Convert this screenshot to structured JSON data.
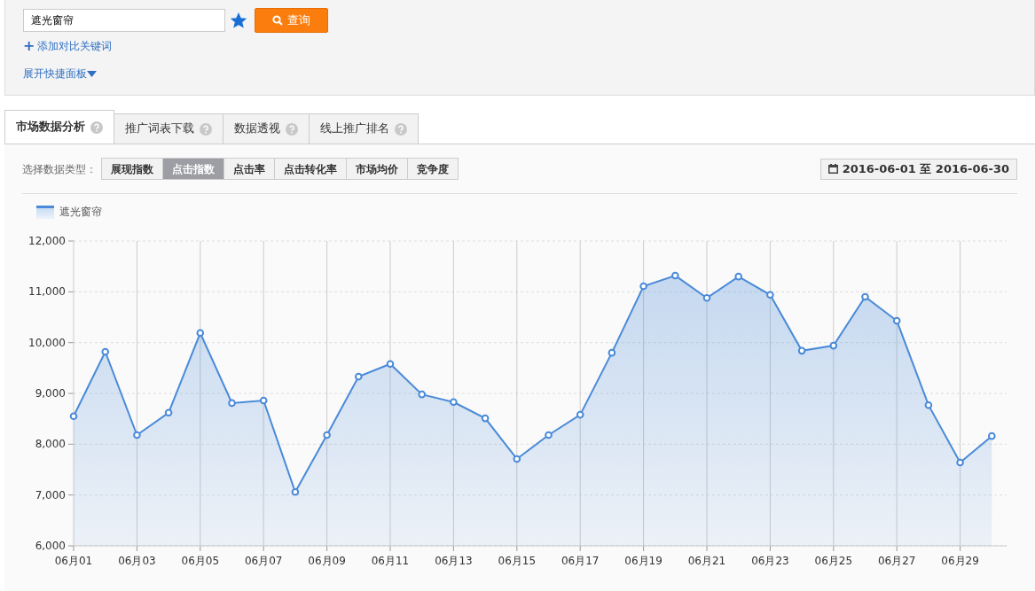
{
  "search": {
    "value": "遮光窗帘",
    "starred": true,
    "button": "查询"
  },
  "add_compare": {
    "icon": "+",
    "label": "添加对比关键词"
  },
  "expand_panel": {
    "label": "展开快捷面板"
  },
  "tabs": [
    {
      "label": "市场数据分析",
      "selected": true
    },
    {
      "label": "推广词表下载",
      "selected": false
    },
    {
      "label": "数据透视",
      "selected": false
    },
    {
      "label": "线上推广排名",
      "selected": false
    }
  ],
  "data_type": {
    "label": "选择数据类型：",
    "options": [
      {
        "label": "展现指数",
        "selected": false
      },
      {
        "label": "点击指数",
        "selected": true
      },
      {
        "label": "点击率",
        "selected": false
      },
      {
        "label": "点击转化率",
        "selected": false
      },
      {
        "label": "市场均价",
        "selected": false
      },
      {
        "label": "竞争度",
        "selected": false
      }
    ]
  },
  "date_range": "2016-06-01 至 2016-06-30",
  "chart": {
    "chart_data": {
      "type": "area",
      "series": [
        {
          "name": "遮光窗帘",
          "color": "#4a8ad8",
          "values": [
            8550,
            9820,
            8180,
            8620,
            10190,
            8810,
            8860,
            7060,
            8180,
            9330,
            9580,
            8980,
            8830,
            8510,
            7710,
            8180,
            8580,
            9800,
            11110,
            11320,
            10880,
            11300,
            10940,
            9840,
            9940,
            10900,
            10430,
            8770,
            7640,
            8160
          ]
        }
      ],
      "ylim": [
        6000,
        12000
      ],
      "yticks": [
        {
          "value": 6000,
          "label": "6,000"
        },
        {
          "value": 7000,
          "label": "7,000"
        },
        {
          "value": 8000,
          "label": "8,000"
        },
        {
          "value": 9000,
          "label": "9,000"
        },
        {
          "value": 10000,
          "label": "10,000"
        },
        {
          "value": 11000,
          "label": "11,000"
        },
        {
          "value": 12000,
          "label": "12,000"
        }
      ],
      "grid": true,
      "categories": [
        "06月01",
        null,
        "06月03",
        null,
        "06月05",
        null,
        "06月07",
        null,
        "06月09",
        null,
        "06月11",
        null,
        "06月13",
        null,
        "06月15",
        null,
        "06月17",
        null,
        "06月19",
        null,
        "06月21",
        null,
        "06月23",
        null,
        "06月25",
        null,
        "06月27",
        null,
        "06月29",
        null
      ]
    }
  }
}
